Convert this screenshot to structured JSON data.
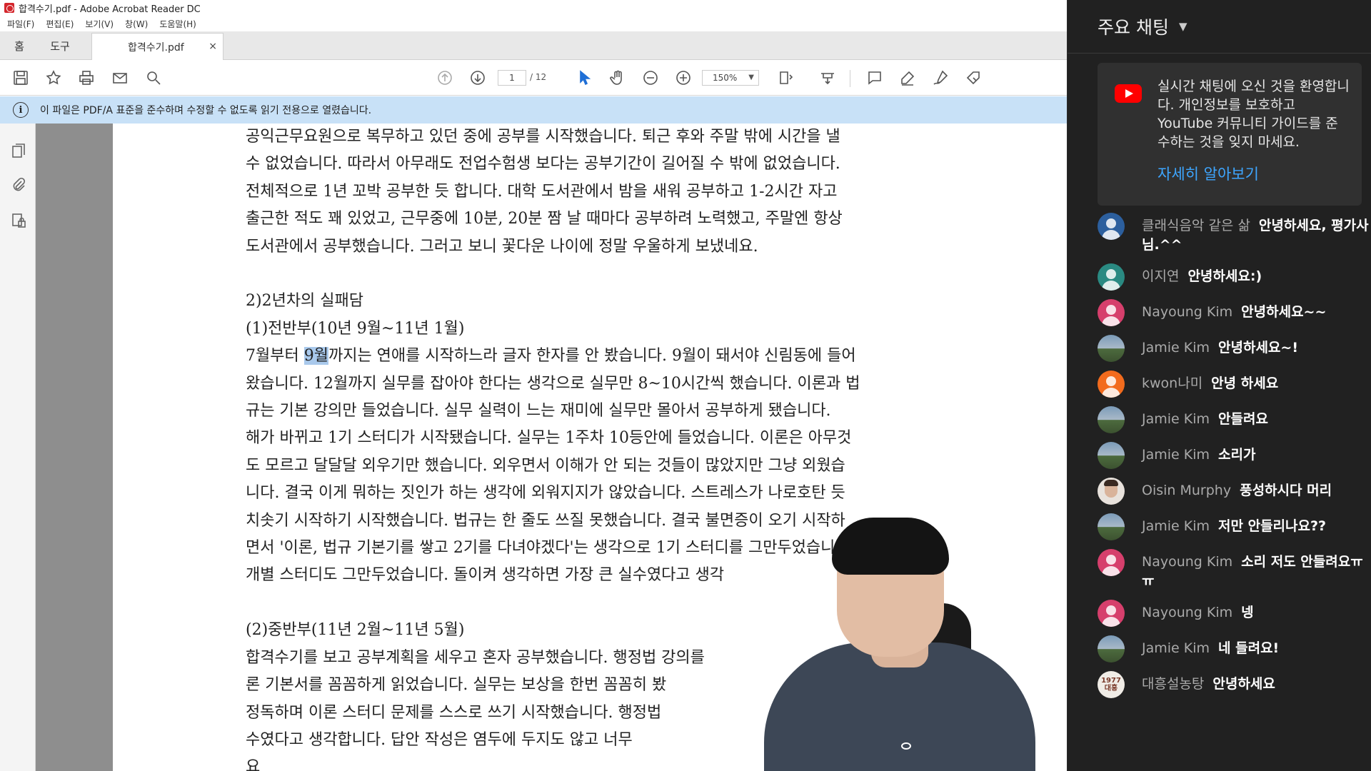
{
  "window": {
    "title": "합격수기.pdf - Adobe Acrobat Reader DC"
  },
  "menu": [
    "파일(F)",
    "편집(E)",
    "보기(V)",
    "창(W)",
    "도움말(H)"
  ],
  "tabs": {
    "home": "홈",
    "tools": "도구",
    "document": "합격수기.pdf",
    "close": "×"
  },
  "toolbar": {
    "page_current": "1",
    "page_total": "/ 12",
    "zoom": "150%"
  },
  "infobar": {
    "message": "이 파일은 PDF/A 표준을 준수하며 수정할 수 없도록 읽기 전용으로 열렸습니다."
  },
  "document": {
    "lines": [
      " 공익근무요원으로 복무하고 있던 중에 공부를 시작했습니다. 퇴근 후와 주말 밖에 시간을 낼",
      "수 없었습니다. 따라서 아무래도 전업수험생 보다는 공부기간이 길어질 수 밖에 없었습니다.",
      "전체적으로 1년 꼬박 공부한 듯 합니다. 대학 도서관에서 밤을 새워 공부하고 1-2시간 자고",
      "출근한 적도 꽤 있었고, 근무중에 10분, 20분 짬 날 때마다 공부하려 노력했고, 주말엔 항상",
      "도서관에서 공부했습니다. 그러고 보니 꽃다운 나이에 정말 우울하게 보냈네요.",
      "",
      "2)2년차의 실패담",
      "(1)전반부(10년 9월~11년 1월)",
      "",
      "왔습니다. 12월까지 실무를 잡아야 한다는 생각으로 실무만 8~10시간씩 했습니다. 이론과 법",
      "규는 기본 강의만 들었습니다. 실무 실력이 느는 재미에 실무만 몰아서 공부하게 됐습니다.",
      "해가 바뀌고 1기 스터디가 시작됐습니다. 실무는 1주차 10등안에 들었습니다. 이론은 아무것",
      "도 모르고 달달달 외우기만 했습니다. 외우면서 이해가 안 되는 것들이 많았지만 그냥 외웠습",
      "니다. 결국 이게 뭐하는 짓인가 하는 생각에 외워지지가 않았습니다. 스트레스가 나로호탄 듯",
      "치솟기 시작하기 시작했습니다. 법규는 한 줄도 쓰질 못했습니다. 결국 불면증이 오기 시작하",
      "면서 '이론, 법규 기본기를 쌓고 2기를 다녀야겠다'는 생각으로 1기 스터디를 그만두었습니다.",
      "개별 스터디도 그만두었습니다. 돌이켜 생각하면 가장 큰 실수였다고 생각",
      "",
      "(2)중반부(11년 2월~11년 5월)",
      "합격수기를 보고 공부계획을 세우고 혼자 공부했습니다. 행정법 강의를",
      "론 기본서를 꼼꼼하게 읽었습니다. 실무는 보상을 한번 꼼꼼히 봤",
      "정독하며 이론 스터디 문제를 스스로 쓰기 시작했습니다. 행정법",
      "수였다고 생각합니다. 답안 작성은 염두에 두지도 않고 너무",
      "요"
    ],
    "highlight_line": {
      "before": "7월부터 ",
      "highlighted": "9월",
      "after": "까지는 연애를 시작하느라 글자 한자를 안 봤습니다. 9월이 돼서야 신림동에 들어"
    }
  },
  "chat": {
    "header": "주요 채팅",
    "welcome_text": "실시간 채팅에 오신 것을 환영합니다. 개인정보를 보호하고 YouTube 커뮤니티 가이드를 준수하는 것을 잊지 마세요.",
    "welcome_link": "자세히 알아보기",
    "messages": [
      {
        "author": "클래식음악 같은 삶",
        "text": "안녕하세요, 평가사님.^^",
        "avatar": "default",
        "color": "#2c5f9e"
      },
      {
        "author": "이지연",
        "text": "안녕하세요:)",
        "avatar": "default",
        "color": "#2a8a82"
      },
      {
        "author": "Nayoung Kim",
        "text": "안녕하세요~~",
        "avatar": "default",
        "color": "#d63f6c"
      },
      {
        "author": "Jamie Kim",
        "text": "안녕하세요~!",
        "avatar": "scene",
        "color": "#6b8aa5"
      },
      {
        "author": "kwon나미",
        "text": "안녕 하세요",
        "avatar": "default",
        "color": "#f26b1d"
      },
      {
        "author": "Jamie Kim",
        "text": "안들려요",
        "avatar": "scene",
        "color": "#6b8aa5"
      },
      {
        "author": "Jamie Kim",
        "text": "소리가",
        "avatar": "scene",
        "color": "#6b8aa5"
      },
      {
        "author": "Oisin Murphy",
        "text": "풍성하시다 머리",
        "avatar": "photo",
        "color": "#e8e2dc"
      },
      {
        "author": "Jamie Kim",
        "text": "저만 안들리나요??",
        "avatar": "scene",
        "color": "#6b8aa5"
      },
      {
        "author": "Nayoung Kim",
        "text": "소리 저도 안들려요ㅠㅠ",
        "avatar": "default",
        "color": "#d63f6c"
      },
      {
        "author": "Nayoung Kim",
        "text": "넹",
        "avatar": "default",
        "color": "#d63f6c"
      },
      {
        "author": "Jamie Kim",
        "text": "네 들려요!",
        "avatar": "scene",
        "color": "#6b8aa5"
      },
      {
        "author": "대흥설농탕",
        "text": "안녕하세요",
        "avatar": "badge",
        "color": "#f0ece6",
        "badge": "1977 대흥"
      }
    ]
  }
}
